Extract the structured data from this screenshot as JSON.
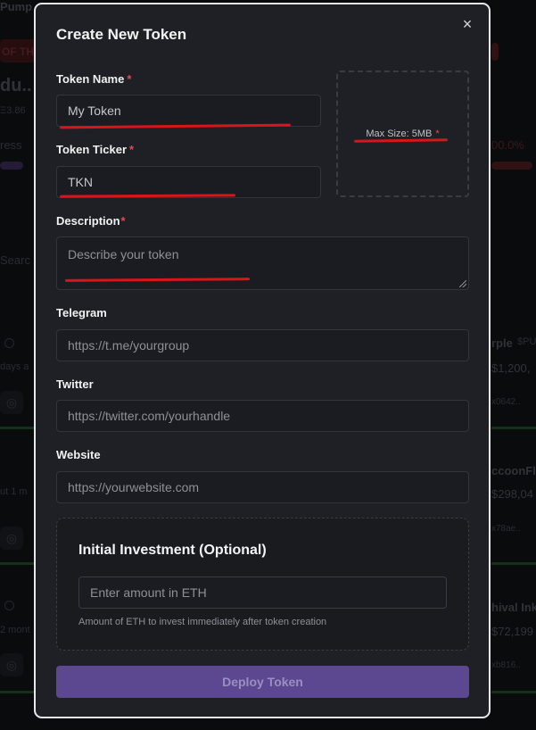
{
  "background": {
    "nav_fragment": "Pump",
    "banner_fragment": "OF TH",
    "token_fragment": "du..",
    "price_fragment": "Ξ3.86",
    "progress_label": "ress",
    "progress_pct": "00.0%",
    "search_fragment": "Searc",
    "cards": [
      {
        "name": "rple",
        "ticker": "$PU",
        "left_meta": "days a",
        "amount": "$1,200,",
        "addr": "x0642.."
      },
      {
        "name": "ccoonFl",
        "ticker": "",
        "left_meta": "ut 1 m",
        "amount": "$298,04",
        "addr": "x78ae.."
      },
      {
        "name": "hival Ink",
        "ticker": "",
        "left_meta": "2 mont",
        "amount": "$72,199",
        "addr": "xb816.."
      }
    ]
  },
  "modal": {
    "title": "Create New Token",
    "close_glyph": "×",
    "token_name": {
      "label": "Token Name",
      "required": "*",
      "value": "My Token"
    },
    "token_ticker": {
      "label": "Token Ticker",
      "required": "*",
      "value": "TKN"
    },
    "upload": {
      "text": "Max Size: 5MB",
      "required": "*"
    },
    "description": {
      "label": "Description",
      "required": "*",
      "placeholder": "Describe your token"
    },
    "telegram": {
      "label": "Telegram",
      "placeholder": "https://t.me/yourgroup"
    },
    "twitter": {
      "label": "Twitter",
      "placeholder": "https://twitter.com/yourhandle"
    },
    "website": {
      "label": "Website",
      "placeholder": "https://yourwebsite.com"
    },
    "investment": {
      "title": "Initial Investment (Optional)",
      "placeholder": "Enter amount in ETH",
      "help": "Amount of ETH to invest immediately after token creation"
    },
    "deploy_label": "Deploy Token"
  },
  "colors": {
    "modal_bg": "#1f2025",
    "required": "#e5484d",
    "deploy_bg": "#5b4891",
    "annotation_red": "#d9141a"
  }
}
